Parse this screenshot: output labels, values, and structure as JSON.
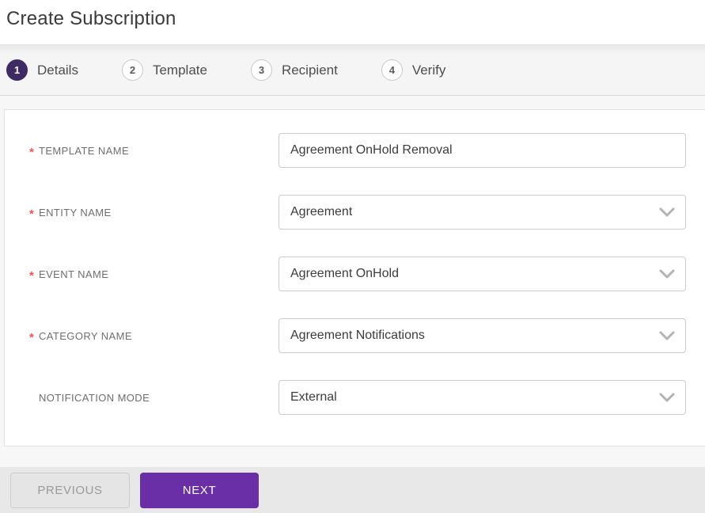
{
  "page": {
    "title": "Create Subscription"
  },
  "stepper": {
    "steps": [
      {
        "number": "1",
        "label": "Details",
        "active": true
      },
      {
        "number": "2",
        "label": "Template",
        "active": false
      },
      {
        "number": "3",
        "label": "Recipient",
        "active": false
      },
      {
        "number": "4",
        "label": "Verify",
        "active": false
      }
    ]
  },
  "form": {
    "required_marker": "*",
    "fields": [
      {
        "label": "TEMPLATE NAME",
        "required": true,
        "type": "text",
        "value": "Agreement OnHold Removal"
      },
      {
        "label": "ENTITY NAME",
        "required": true,
        "type": "select",
        "value": "Agreement"
      },
      {
        "label": "EVENT NAME",
        "required": true,
        "type": "select",
        "value": "Agreement OnHold"
      },
      {
        "label": "CATEGORY NAME",
        "required": true,
        "type": "select",
        "value": "Agreement Notifications"
      },
      {
        "label": "NOTIFICATION MODE",
        "required": false,
        "type": "select",
        "value": "External"
      }
    ]
  },
  "footer": {
    "previous_label": "PREVIOUS",
    "next_label": "NEXT"
  },
  "colors": {
    "accent_purple": "#6a2fa6",
    "step_active_purple": "#3f2b63",
    "required_red": "#f05454",
    "chevron_gray": "#b3b3b3"
  }
}
